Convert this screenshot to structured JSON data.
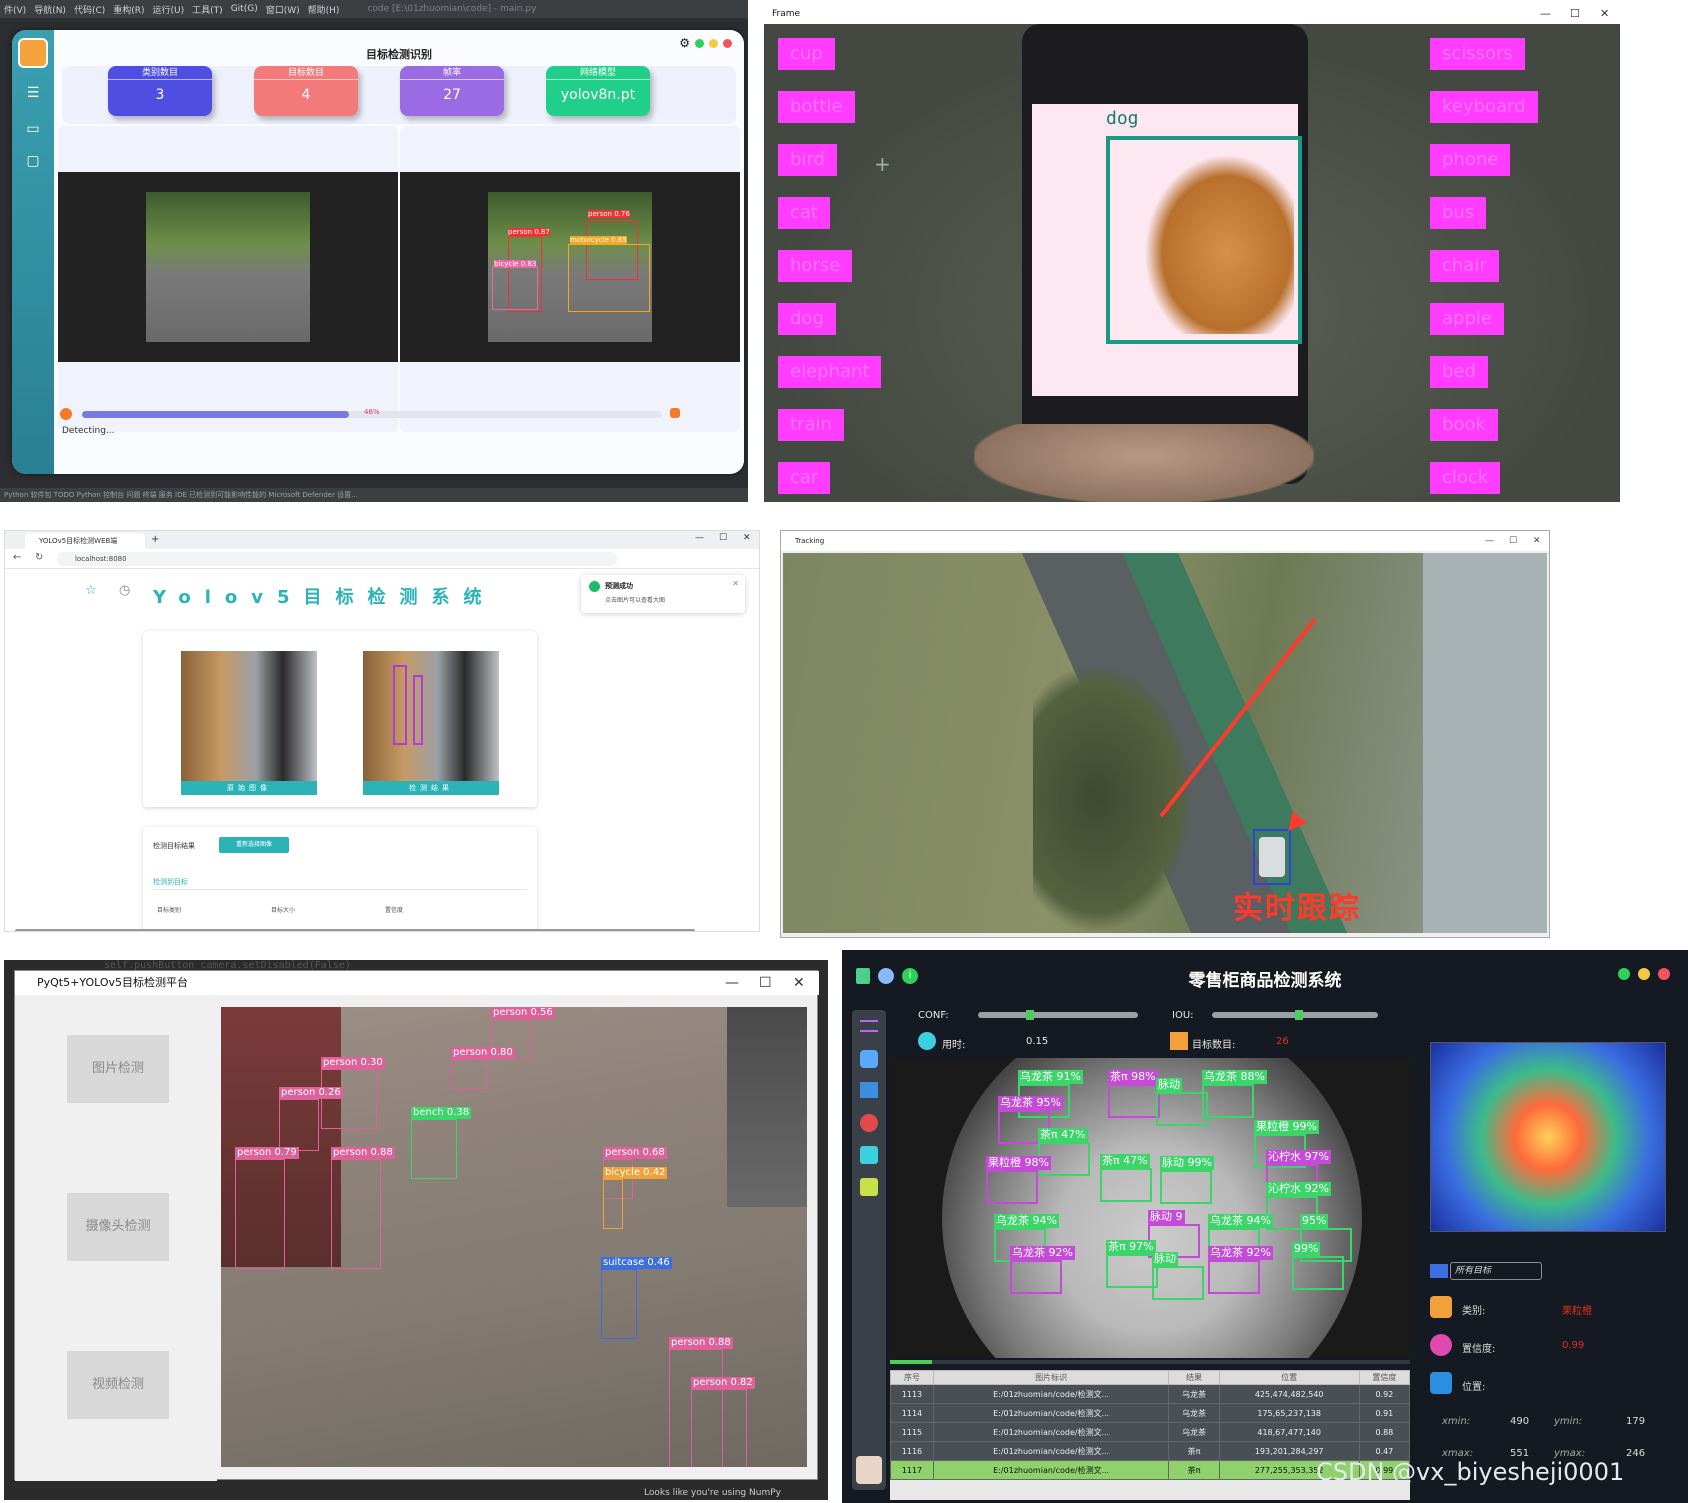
{
  "p1": {
    "menu": [
      "件(V)",
      "导航(N)",
      "代码(C)",
      "重构(R)",
      "运行(U)",
      "工具(T)",
      "Git(G)",
      "窗口(W)",
      "帮助(H)",
      "code [E:\\01zhuomian\\code] - main.py"
    ],
    "app_title": "目标检测识别",
    "cards": [
      {
        "label": "类别数目",
        "value": "3",
        "color": "#4f4ee3"
      },
      {
        "label": "目标数目",
        "value": "4",
        "color": "#f27a7a"
      },
      {
        "label": "帧率",
        "value": "27",
        "color": "#9a6be3"
      },
      {
        "label": "网络模型",
        "value": "yolov8n.pt",
        "color": "#1fcf8a"
      }
    ],
    "detections": [
      "person 0.87",
      "person 0.76",
      "motorcycle 0.65",
      "bicycle 0.83"
    ],
    "progress_percent": 46,
    "progress_text": "46%",
    "status": "Detecting...",
    "ide_status": "Python 软件包   TODO   Python 控制台   问题   终端   服务   IDE 已检测到可能影响性能的 Microsoft Defender 设置...",
    "gear_icon": "gear-icon"
  },
  "p2": {
    "window_title": "Frame",
    "left_labels": [
      "cup",
      "bottle",
      "bird",
      "cat",
      "horse",
      "dog",
      "elephant",
      "train",
      "car"
    ],
    "right_labels": [
      "scissors",
      "keyboard",
      "phone",
      "bus",
      "chair",
      "apple",
      "bed",
      "book",
      "clock"
    ],
    "detection_label": "dog",
    "tag_color": "#ff3cff"
  },
  "p3": {
    "tab_title": "YOLOv5目标检测WEB端",
    "url": "localhost:8080",
    "heading": "Yolov5目标检测系统",
    "toast_title": "预测成功",
    "toast_text": "点击图片可以查看大图",
    "caption_original": "原始图像",
    "caption_result": "检测结果",
    "results_label": "检测目标结果",
    "reupload_button": "重新选择图像",
    "tab_detected": "检测到目标",
    "col_headers": [
      "目标类别",
      "目标大小",
      "置信度"
    ],
    "accent": "#2bb3b8"
  },
  "p4": {
    "window_title": "Tracking",
    "overlay_text": "实时跟踪"
  },
  "p5": {
    "ide_hint": "self.pushButton_camera.setDisabled(False)",
    "window_title": "PyQt5+YOLOv5目标检测平台",
    "buttons": [
      "图片检测",
      "摄像头检测",
      "视频检测"
    ],
    "detections": [
      {
        "label": "person 0.56"
      },
      {
        "label": "person 0.80"
      },
      {
        "label": "person 0.30"
      },
      {
        "label": "person 0.26"
      },
      {
        "label": "bench 0.38"
      },
      {
        "label": "person 0.88"
      },
      {
        "label": "person 0.79"
      },
      {
        "label": "person 0.68"
      },
      {
        "label": "bicycle 0.42"
      },
      {
        "label": "suitcase 0.46"
      },
      {
        "label": "person 0.88"
      },
      {
        "label": "person 0.82"
      }
    ],
    "footer": "Looks like you're using NumPy"
  },
  "p6": {
    "title": "零售柜商品检测系统",
    "conf_label": "CONF:",
    "iou_label": "IOU:",
    "conf_value": 0.3,
    "iou_value": 0.5,
    "time_label": "用时:",
    "time_value": "0.15",
    "count_label": "目标数目:",
    "count_value": "26",
    "detections": [
      "乌龙茶 91%",
      "茶π 98%",
      "脉动",
      "乌龙茶 88%",
      "乌龙茶 95%",
      "茶π 47%",
      "果粒橙 99%",
      "果粒橙 98%",
      "茶π 47%",
      "脉动 99%",
      "沁柠水 97%",
      "沁柠水 92%",
      "乌龙茶 94%",
      "脉动 9",
      "乌龙茶 94%",
      "95%",
      "乌龙茶 92%",
      "茶π 97%",
      "脉动",
      "乌龙茶 92%",
      "99%"
    ],
    "table_headers": [
      "序号",
      "图片标识",
      "结果",
      "位置",
      "置信度"
    ],
    "table_rows": [
      [
        "1113",
        "E:/01zhuomian/code/检测文...",
        "乌龙茶",
        "425,474,482,540",
        "0.92"
      ],
      [
        "1114",
        "E:/01zhuomian/code/检测文...",
        "乌龙茶",
        "175,65,237,138",
        "0.91"
      ],
      [
        "1115",
        "E:/01zhuomian/code/检测文...",
        "乌龙茶",
        "418,67,477,140",
        "0.88"
      ],
      [
        "1116",
        "E:/01zhuomian/code/检测文...",
        "茶π",
        "193,201,284,297",
        "0.47"
      ],
      [
        "1117",
        "E:/01zhuomian/code/检测文...",
        "茶π",
        "277,255,353,352",
        "0.99"
      ]
    ],
    "filter_value": "所有目标",
    "class_label": "类别:",
    "class_value": "果粒橙",
    "conf_info_label": "置信度:",
    "conf_info_value": "0.99",
    "position_label": "位置:",
    "xmin_label": "xmin:",
    "xmin": "490",
    "ymin_label": "ymin:",
    "ymin": "179",
    "xmax_label": "xmax:",
    "xmax": "551",
    "ymax_label": "ymax:",
    "ymax": "246",
    "watermark": "CSDN @vx_biyesheji0001"
  }
}
